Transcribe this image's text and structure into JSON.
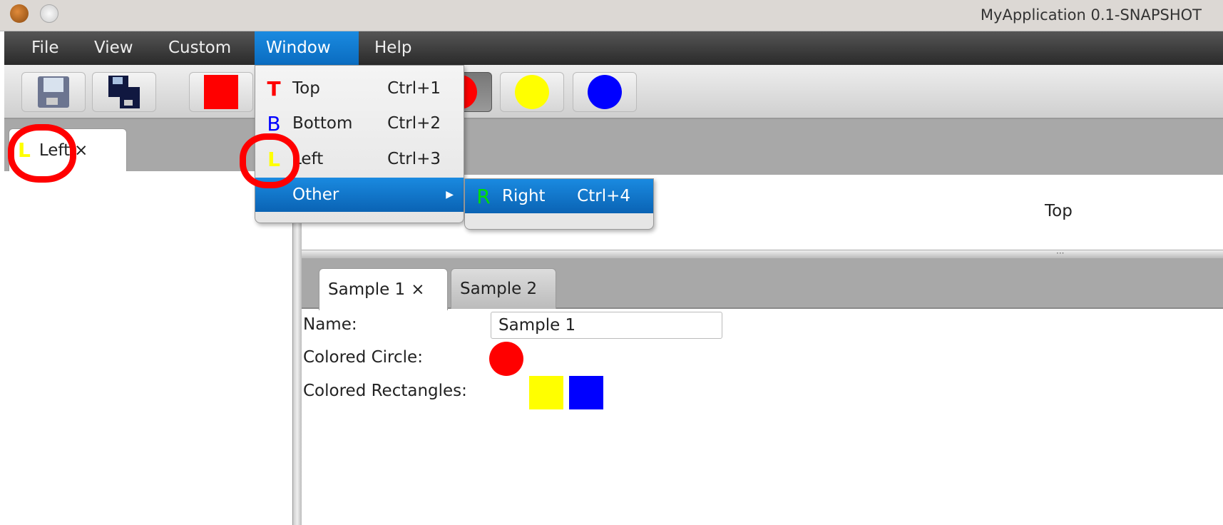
{
  "window": {
    "title": "MyApplication 0.1-SNAPSHOT"
  },
  "menubar": {
    "items": [
      {
        "label": "File"
      },
      {
        "label": "View"
      },
      {
        "label": "Custom"
      },
      {
        "label": "Window"
      },
      {
        "label": "Help"
      }
    ]
  },
  "toolbar": {
    "buttons": [
      {
        "icon": "floppy-save-icon"
      },
      {
        "icon": "floppy-save-all-icon"
      },
      {
        "icon": "red-square-icon",
        "color": "#ff0000"
      },
      {
        "icon": "red-circle-icon",
        "color": "#ff0000",
        "pressed": true
      },
      {
        "icon": "yellow-circle-icon",
        "color": "#ffff00"
      },
      {
        "icon": "blue-circle-icon",
        "color": "#0000ff"
      }
    ]
  },
  "window_menu": {
    "items": [
      {
        "icon_letter": "T",
        "icon_color": "#ff0000",
        "label": "Top",
        "shortcut": "Ctrl+1"
      },
      {
        "icon_letter": "B",
        "icon_color": "#0000ff",
        "label": "Bottom",
        "shortcut": "Ctrl+2"
      },
      {
        "icon_letter": "L",
        "icon_color": "#ffff00",
        "label": "Left",
        "shortcut": "Ctrl+3"
      },
      {
        "label": "Other",
        "submenu": true
      }
    ],
    "submenu": {
      "items": [
        {
          "icon_letter": "R",
          "icon_color": "#00dd00",
          "label": "Right",
          "shortcut": "Ctrl+4"
        }
      ]
    }
  },
  "left_panel": {
    "tab": {
      "icon_letter": "L",
      "label": "Left",
      "close": "×"
    }
  },
  "top_panel": {
    "label": "Top"
  },
  "bottom_panel": {
    "tabs": [
      {
        "label": "Sample 1",
        "close": "×"
      },
      {
        "label": "Sample 2"
      }
    ],
    "form": {
      "name_label": "Name:",
      "name_value": "Sample 1",
      "circle_label": "Colored Circle:",
      "circle_color": "#ff0000",
      "rect_label": "Colored Rectangles:",
      "rect_colors": [
        "#ffff00",
        "#0000ff"
      ]
    }
  },
  "annotations": {
    "color": "#ff0000"
  }
}
